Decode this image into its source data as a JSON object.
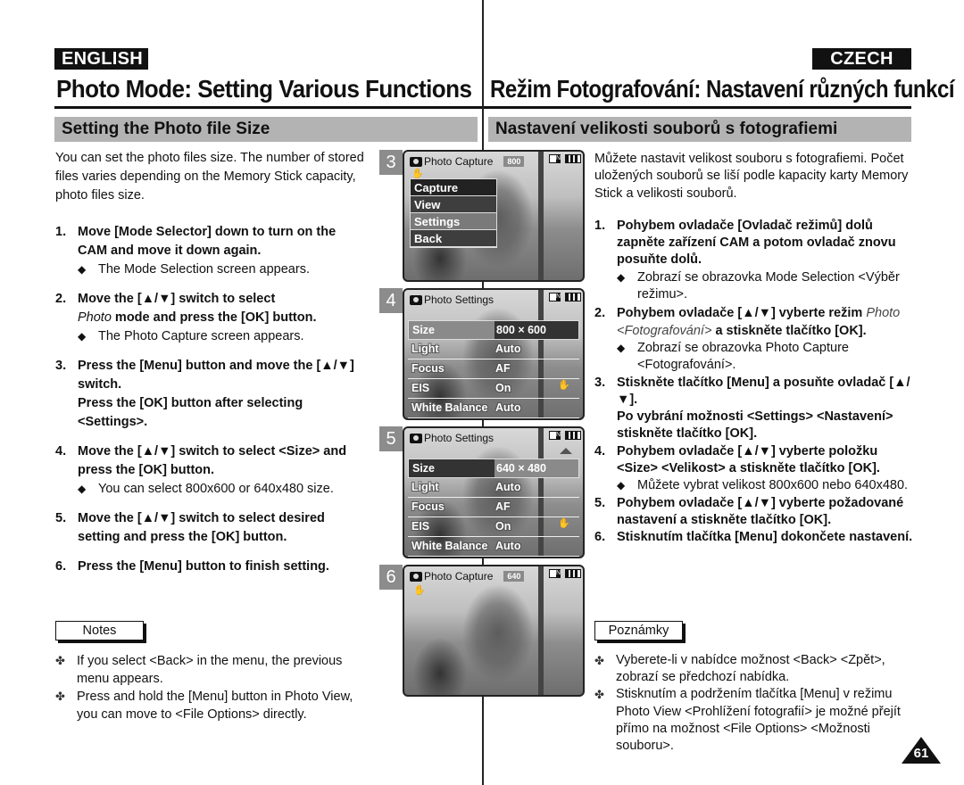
{
  "header": {
    "lang_left": "ENGLISH",
    "lang_right": "CZECH",
    "title_en": "Photo Mode: Setting Various Functions",
    "title_cz": "Režim Fotografování: Nastavení různých funkcí",
    "section_en": "Setting the Photo file Size",
    "section_cz": "Nastavení velikosti souborů s fotografiemi"
  },
  "english": {
    "intro": "You can set the photo files size. The number of stored files varies depending on the Memory Stick capacity, photo files size.",
    "steps": [
      {
        "num": "1.",
        "text": "Move [Mode Selector] down to turn on the CAM and move it down again.",
        "bullet": "The Mode Selection screen appears."
      },
      {
        "num": "2.",
        "text_italic": "Photo",
        "text": " mode and press the [OK] button.",
        "text_pre": "Move the [▲/▼] switch to select",
        "bullet": "The Photo Capture screen appears."
      },
      {
        "num": "3.",
        "text": "Press the [Menu] button and move the [▲/▼] switch.",
        "text2": "Press the [OK] button after selecting <Settings>."
      },
      {
        "num": "4.",
        "text": "Move the [▲/▼] switch to select <Size> and press the [OK] button.",
        "bullet": "You can select 800x600 or 640x480 size."
      },
      {
        "num": "5.",
        "text": "Move the [▲/▼] switch to select desired setting and press the [OK] button."
      },
      {
        "num": "6.",
        "text": "Press the [Menu] button to finish setting."
      }
    ],
    "notes_label": "Notes",
    "notes": [
      "If you select <Back> in the menu, the previous menu appears.",
      "Press and hold the [Menu] button in Photo View, you can move to <File Options> directly."
    ]
  },
  "czech": {
    "intro": "Můžete nastavit velikost souboru s fotografiemi. Počet uložených souborů se liší podle kapacity karty Memory Stick a velikosti souborů.",
    "steps": [
      {
        "num": "1.",
        "text": "Pohybem ovladače [Ovladač režimů] dolů zapněte zařízení CAM a potom ovladač znovu posuňte dolů.",
        "bullet": "Zobrazí se obrazovka Mode Selection <Výběr režimu>."
      },
      {
        "num": "2.",
        "text_pre": "Pohybem ovladače [▲/▼] vyberte režim",
        "text_italic": "Photo <Fotografování>",
        "text": " a stiskněte tlačítko [OK].",
        "bullet": "Zobrazí se obrazovka Photo Capture <Fotografování>."
      },
      {
        "num": "3.",
        "text": "Stiskněte tlačítko [Menu] a posuňte ovladač [▲/▼].",
        "text2": "Po vybrání možnosti <Settings> <Nastavení> stiskněte tlačítko [OK]."
      },
      {
        "num": "4.",
        "text": "Pohybem ovladače [▲/▼] vyberte položku <Size> <Velikost> a stiskněte tlačítko [OK].",
        "bullet": "Můžete vybrat velikost 800x600 nebo 640x480."
      },
      {
        "num": "5.",
        "text": "Pohybem ovladače [▲/▼] vyberte požadované nastavení a stiskněte tlačítko [OK]."
      },
      {
        "num": "6.",
        "text": "Stisknutím tlačítka [Menu] dokončete nastavení."
      }
    ],
    "notes_label": "Poznámky",
    "notes": [
      "Vyberete-li v nabídce možnost <Back> <Zpět>, zobrazí se předchozí nabídka.",
      "Stisknutím a podržením tlačítka [Menu] v režimu Photo View <Prohlížení fotografií> je možné přejít přímo na možnost <File Options> <Možnosti souboru>."
    ]
  },
  "screens": [
    {
      "num": "3",
      "title": "Photo Capture",
      "res": "800",
      "menu": [
        "Capture",
        "View",
        "Settings",
        "Back"
      ],
      "highlighted": "Settings"
    },
    {
      "num": "4",
      "title": "Photo Settings",
      "rows": [
        {
          "k": "Size",
          "v": "800 × 600"
        },
        {
          "k": "Light",
          "v": "Auto"
        },
        {
          "k": "Focus",
          "v": "AF"
        },
        {
          "k": "EIS",
          "v": "On"
        },
        {
          "k": "White Balance",
          "v": "Auto"
        }
      ]
    },
    {
      "num": "5",
      "title": "Photo Settings",
      "rows": [
        {
          "k": "Size",
          "v": "640 × 480"
        },
        {
          "k": "Light",
          "v": "Auto"
        },
        {
          "k": "Focus",
          "v": "AF"
        },
        {
          "k": "EIS",
          "v": "On"
        },
        {
          "k": "White Balance",
          "v": "Auto"
        }
      ]
    },
    {
      "num": "6",
      "title": "Photo Capture",
      "res": "640"
    }
  ],
  "glyphs": {
    "diamond": "◆",
    "clover": "✤",
    "hand": "✋"
  },
  "page_number": "61"
}
